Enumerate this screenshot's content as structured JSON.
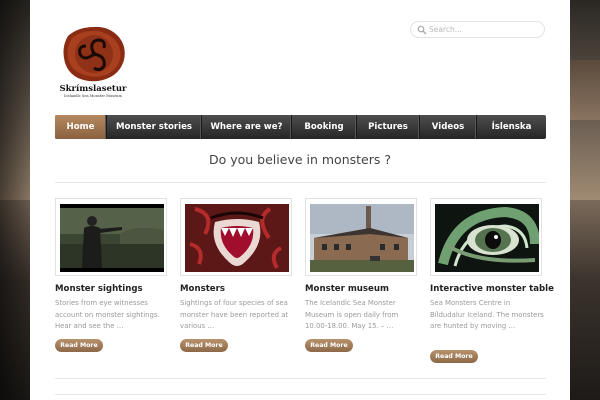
{
  "site": {
    "logo_name": "Skrímslasetur",
    "logo_subtitle": "Icelandic Sea Monster Museum"
  },
  "search": {
    "placeholder": "Search..."
  },
  "nav": {
    "items": [
      {
        "label": "Home",
        "active": true
      },
      {
        "label": "Monster stories"
      },
      {
        "label": "Where are we?"
      },
      {
        "label": "Booking"
      },
      {
        "label": "Pictures"
      },
      {
        "label": "Videos"
      },
      {
        "label": "Íslenska"
      }
    ]
  },
  "tagline": "Do you believe in monsters ?",
  "cards": [
    {
      "title": "Monster sightings",
      "excerpt": "Stories from eye witnesses account on monster sightings. Hear and see the …",
      "button": "Read More",
      "image": "person-on-shore"
    },
    {
      "title": "Monsters",
      "excerpt": "Sightings of four species of sea monster have been reported at various …",
      "button": "Read More",
      "image": "monster-mouth"
    },
    {
      "title": "Monster museum",
      "excerpt": "The Icelandic Sea Monster Museum is open daily from 10.00-18.00. May 15. – …",
      "button": "Read More",
      "image": "museum-building"
    },
    {
      "title": "Interactive monster table",
      "excerpt": "Sea Monsters Centre in Bíldudalur Iceland. The monsters are hunted by moving …",
      "button": "Read More",
      "image": "monster-eye"
    }
  ],
  "colors": {
    "accent": "#a07a55",
    "nav_bg": "#333333",
    "text_muted": "#9a9a9a"
  }
}
